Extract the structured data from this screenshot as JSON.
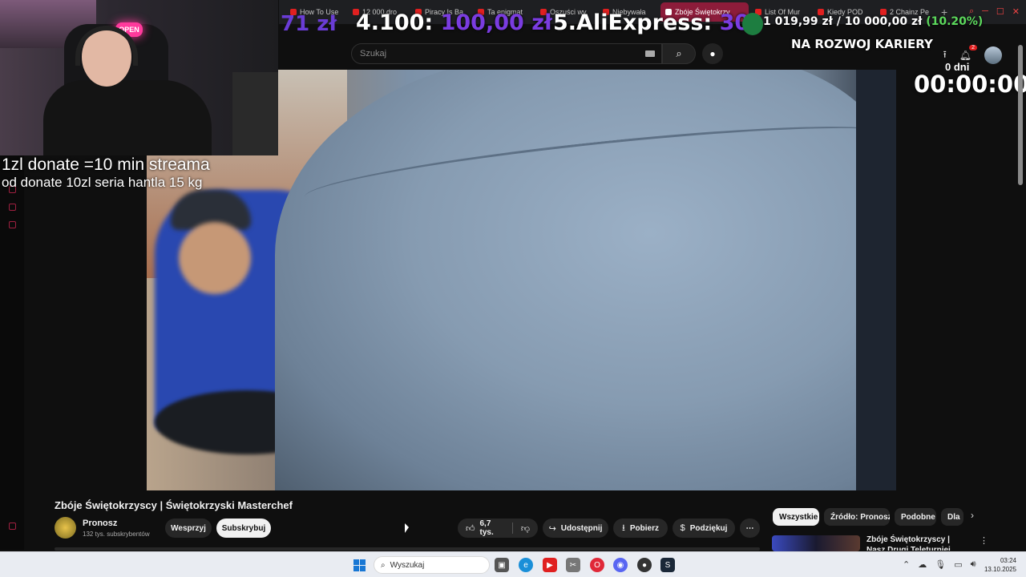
{
  "browser": {
    "tabs": [
      {
        "label": "How To Use"
      },
      {
        "label": "12 000 dro"
      },
      {
        "label": "Piracy Is Ba"
      },
      {
        "label": "Ta enigmat"
      },
      {
        "label": "Oszuści wy"
      },
      {
        "label": "Niebywała"
      },
      {
        "label": "Zbóje Świętokrzy",
        "active": true
      },
      {
        "label": "List Of Mur"
      },
      {
        "label": "Kiedy POD"
      },
      {
        "label": "2 Chainz Pe"
      }
    ],
    "new_tab": "+"
  },
  "youtube": {
    "search_placeholder": "Szukaj",
    "notification_count": "2"
  },
  "stream_overlay": {
    "amount": "71 zł",
    "goal4_label": "4.100:",
    "goal4_value": "100,00 zł",
    "goal5_label": "5.AliExpress:",
    "goal5_value": "30",
    "progress_text": "1 019,99 zł / 10 000,00 zł",
    "progress_pct": "(10.20%)",
    "career_text": "NA ROZWOJ KARIERY",
    "days": "0 dni",
    "timer": "00:00:00",
    "donate_line1": "1zl donate =10 min streama",
    "donate_line2": "od donate 10zl seria hantla 15 kg",
    "webcam_sign": "OPEN"
  },
  "video": {
    "title": "Zbóje Świętokrzyscy | Świętokrzyski Masterchef",
    "channel_name": "Pronosz",
    "channel_subs": "132 tys. subskrybentów",
    "support_label": "Wesprzyj",
    "subscribe_label": "Subskrybuj",
    "likes": "6,7 tys.",
    "share_label": "Udostępnij",
    "download_label": "Pobierz",
    "thanks_label": "Podziękuj",
    "more_label": "⋯"
  },
  "chips": [
    "Wszystkie",
    "Źródło: Pronosz",
    "Podobne",
    "Dla"
  ],
  "recommended": {
    "title": "Zbóje Świętokrzyscy | Nasz Drugi Teleturniej"
  },
  "taskbar": {
    "search_placeholder": "Wyszukaj",
    "time": "03:24",
    "date": "13.10.2025"
  },
  "colors": {
    "overlay_purple": "#7a3ce0",
    "overlay_green": "#5cd95c",
    "yt_bg": "#0f0f0f"
  }
}
